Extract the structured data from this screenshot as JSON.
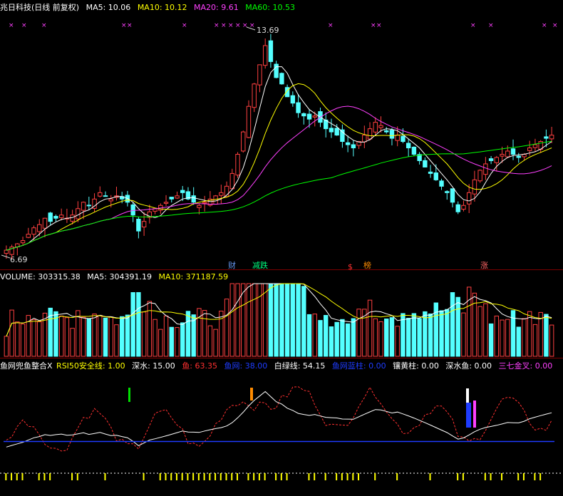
{
  "header": {
    "title": "兆日科技(日线 前复权)",
    "ma5": "MA5: 10.06",
    "ma10": "MA10: 10.12",
    "ma20": "MA20: 9.61",
    "ma60": "MA60: 10.53"
  },
  "price_panel": {
    "high_label": "13.69",
    "low_label": "6.69",
    "event_tags": [
      {
        "text": "财",
        "color": "#6495ed"
      },
      {
        "text": "减跌",
        "color": "#00ff7f"
      },
      {
        "text": "$",
        "color": "#ff3333"
      },
      {
        "text": "榜",
        "color": "#ff8c00"
      },
      {
        "text": "涨",
        "color": "#ff6666"
      }
    ]
  },
  "volume_panel": {
    "label": "VOLUME: 303315.38",
    "ma5": "MA5: 304391.19",
    "ma10": "MA10: 371187.59"
  },
  "indicator_panel": {
    "name": "鱼网兜鱼整合X",
    "rsi": "RSI50安全线: 1.00",
    "shenshui": "深水: 15.00",
    "yu": "鱼: 63.35",
    "yuwang": "鱼网: 38.00",
    "baiLv": "白绿线: 54.15",
    "blue_bar": "鱼网蓝柱: 0.00",
    "yellow_bar": "镶黄柱: 0.00",
    "deep_fish": "深水鱼: 0.00",
    "golden_cross": "三七金叉: 0.00"
  },
  "colors": {
    "up": "#ff4040",
    "down": "#54ffff",
    "ma5": "#ffffff",
    "ma10": "#ffff00",
    "ma20": "#ff40ff",
    "ma60": "#00ff00"
  },
  "chart_data": {
    "type": "candlestick",
    "title": "兆日科技(日线 前复权)",
    "price_range": [
      6.69,
      13.69
    ],
    "closes": [
      6.8,
      6.9,
      7.0,
      7.1,
      7.3,
      7.5,
      7.6,
      7.8,
      7.7,
      7.8,
      7.9,
      7.8,
      7.9,
      8.1,
      8.3,
      8.2,
      8.4,
      8.6,
      8.5,
      8.4,
      8.5,
      8.4,
      8.3,
      7.9,
      7.4,
      7.7,
      8.0,
      8.1,
      8.2,
      8.3,
      8.4,
      8.5,
      8.6,
      8.4,
      8.3,
      8.2,
      8.3,
      8.4,
      8.5,
      8.6,
      8.8,
      9.2,
      9.8,
      10.5,
      11.3,
      12.0,
      12.6,
      13.2,
      12.7,
      12.2,
      12.0,
      11.6,
      11.4,
      11.1,
      11.0,
      10.9,
      11.0,
      10.8,
      10.6,
      10.5,
      10.4,
      10.2,
      10.1,
      10.0,
      10.2,
      10.4,
      10.6,
      10.8,
      10.7,
      10.5,
      10.3,
      10.4,
      10.2,
      10.0,
      9.8,
      9.6,
      9.4,
      9.2,
      9.0,
      8.8,
      8.6,
      8.3,
      8.0,
      8.2,
      8.6,
      9.0,
      9.3,
      9.5,
      9.6,
      9.7,
      9.8,
      9.9,
      9.8,
      9.7,
      9.8,
      10.0,
      10.1,
      10.2,
      10.3,
      10.4
    ]
  }
}
